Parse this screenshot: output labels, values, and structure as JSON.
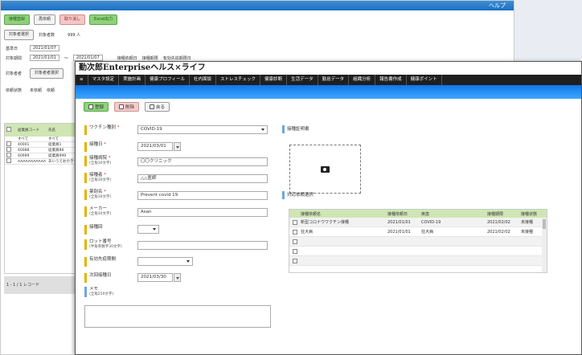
{
  "bg": {
    "top_right": "ヘルプ",
    "toolbar": [
      "接種登録",
      "再依頼",
      "取り消し",
      "Excel出力"
    ],
    "select_label": "対象者選択",
    "count_label": "対象者数",
    "count_value": "999 人",
    "base_date_label": "基準日",
    "base_date": "2021/01/07",
    "period_label": "対象期間",
    "period_from": "2021/01/01",
    "period_to": "2021/01/07",
    "radio_options": [
      "接種依頼日",
      "接種期限",
      "有効先追期限日"
    ],
    "target_label": "対象者者",
    "target_btn": "対象者者選択",
    "status_label": "依頼状態",
    "status_options": [
      "未依頼",
      "依頼"
    ],
    "grid": {
      "headers": [
        "従業員コード",
        "氏名"
      ],
      "filter": [
        "すべて",
        "すべて"
      ],
      "rows": [
        [
          "40001",
          "従業員1"
        ],
        [
          "40088",
          "従業員88"
        ],
        [
          "40999",
          "従業員999"
        ],
        [
          "AAAAAAAAAAA",
          "あいうえおかきく"
        ]
      ]
    },
    "footer": "1 - 1 / 1 レコード"
  },
  "app": {
    "title": "勤次郎Enterpriseヘルス×ライフ",
    "menu": [
      "≡",
      "マスタ設定",
      "実施計画",
      "健康プロフィール",
      "社内面談",
      "ストレスチェック",
      "健康診断",
      "生活データ",
      "勤怠データ",
      "組織分析",
      "報告書作成",
      "健康ポイント"
    ],
    "actions": {
      "save": "登録",
      "delete": "削除",
      "back": "戻る"
    },
    "form": {
      "vaccine_label": "ワクチン種別",
      "vaccine_value": "COVID-19",
      "date_label": "接種日",
      "date_value": "2021/03/01",
      "hospital_label": "接種病院",
      "hospital_hint": "(全角30文字)",
      "hospital_value": "〇〇クリニック",
      "person_label": "接種者",
      "person_hint": "(全角30文字)",
      "person_value": "△△医師",
      "drug_label": "薬剤名",
      "drug_hint": "(全角30文字)",
      "drug_value": "Prevent covid 19",
      "maker_label": "メーカー",
      "maker_hint": "(全角30文字)",
      "maker_value": "Asan",
      "times_label": "接種回",
      "lot_label": "ロット番号",
      "lot_hint": "(半角英数字30文字)",
      "expiry_label": "有効先疫期間",
      "next_label": "次回接種日",
      "next_value": "2021/03/30",
      "memo_label": "メモ",
      "memo_hint": "(全角250文字)"
    },
    "cert_label": "接種証明書",
    "req_label": "対応依頼選択",
    "table": {
      "headers": [
        "接種依頼名",
        "接種依頼日",
        "疾患",
        "接種期限",
        "接種状態"
      ],
      "rows": [
        [
          "新型コロナウワクチン接種",
          "2021/01/01",
          "COVID-19",
          "2021/02/02",
          "未接種"
        ],
        [
          "狂犬病",
          "2021/01/01",
          "狂犬病",
          "2021/02/02",
          "未接種"
        ],
        [
          "",
          "",
          "",
          "",
          ""
        ],
        [
          "",
          "",
          "",
          "",
          ""
        ],
        [
          "",
          "",
          "",
          "",
          ""
        ]
      ]
    }
  }
}
